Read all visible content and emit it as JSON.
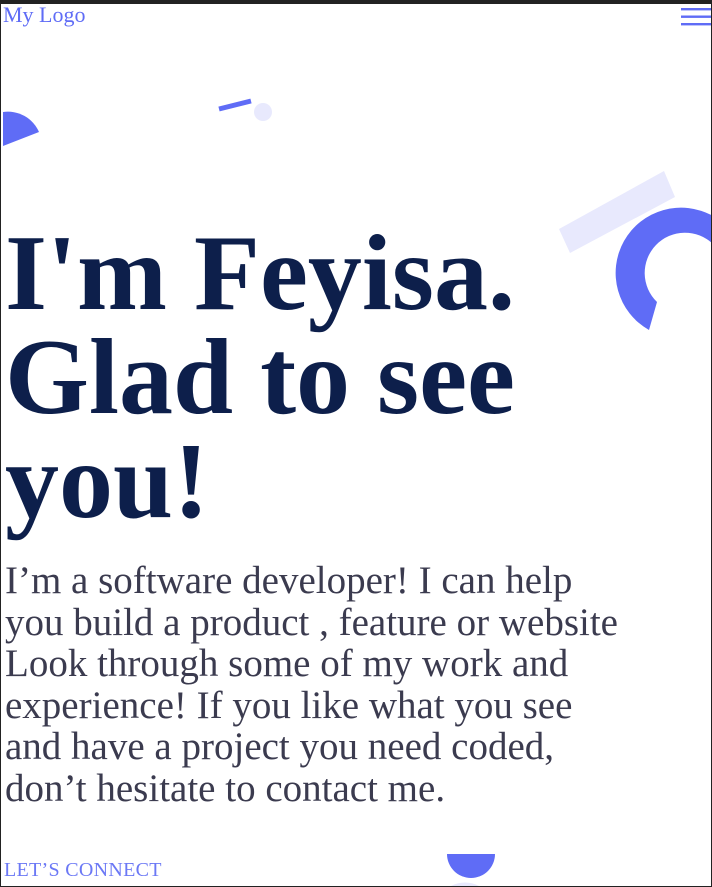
{
  "header": {
    "logo_text": "My Logo",
    "menu_icon": "hamburger-menu-icon"
  },
  "hero": {
    "title_lines": [
      "I'm Feyisa.",
      "Glad to see",
      "you!"
    ],
    "intro_lines": [
      "I’m a software developer! I can help",
      "you build a product , feature or website",
      "Look through some of my work and",
      "experience! If you like what you see",
      "and have a project you need coded,",
      "don’t hesitate to contact me."
    ]
  },
  "cta": {
    "label": "LET’S CONNECT"
  },
  "colors": {
    "accent": "#5f6cf6",
    "accent_light": "#e8e9fd",
    "heading": "#0d1f4b",
    "body_text": "#3b3b4f"
  }
}
